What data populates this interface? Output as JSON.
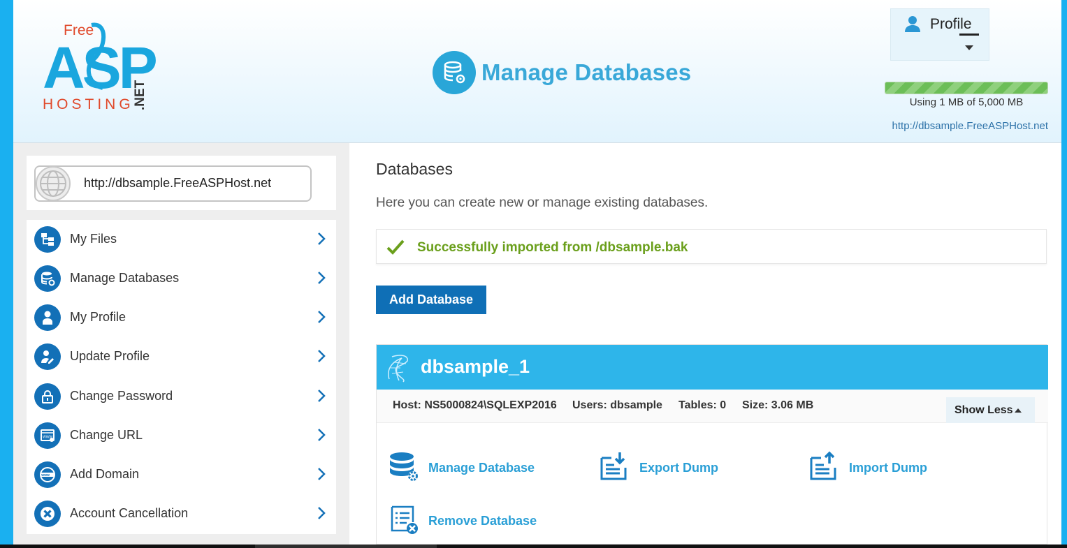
{
  "header": {
    "logo": {
      "free": "Free",
      "asp": "ASP",
      "hosting": "HOSTING",
      "net": ".NET"
    },
    "page_title": "Manage Databases",
    "profile_label": "Profile",
    "usage": {
      "text": "Using 1 MB of 5,000 MB",
      "fill_percent": 100
    },
    "site_url": "http://dbsample.FreeASPHost.net"
  },
  "sidebar": {
    "url": "http://dbsample.FreeASPHost.net",
    "items": [
      {
        "label": "My Files",
        "icon": "files-icon"
      },
      {
        "label": "Manage Databases",
        "icon": "database-icon"
      },
      {
        "label": "My Profile",
        "icon": "user-icon"
      },
      {
        "label": "Update Profile",
        "icon": "user-edit-icon"
      },
      {
        "label": "Change Password",
        "icon": "lock-icon"
      },
      {
        "label": "Change URL",
        "icon": "www-window-icon"
      },
      {
        "label": "Add Domain",
        "icon": "www-globe-icon"
      },
      {
        "label": "Account Cancellation",
        "icon": "close-circle-icon"
      }
    ]
  },
  "main": {
    "section_title": "Databases",
    "description": "Here you can create new or manage existing databases.",
    "alert": "Successfully imported from /dbsample.bak",
    "add_button": "Add Database",
    "database": {
      "name": "dbsample_1",
      "host": "Host: NS5000824\\SQLEXP2016",
      "users": "Users: dbsample",
      "tables": "Tables: 0",
      "size": "Size: 3.06 MB",
      "show_less": "Show Less",
      "actions": {
        "manage": "Manage Database",
        "export": "Export Dump",
        "import": "Import Dump",
        "remove": "Remove Database"
      }
    }
  },
  "colors": {
    "page_border": "#1ab0f0",
    "accent": "#2eb5ea",
    "primary_button": "#0f6fb6",
    "sidebar_icon": "#1370b7",
    "success": "#6a9f1b",
    "link": "#2a9fd6"
  }
}
